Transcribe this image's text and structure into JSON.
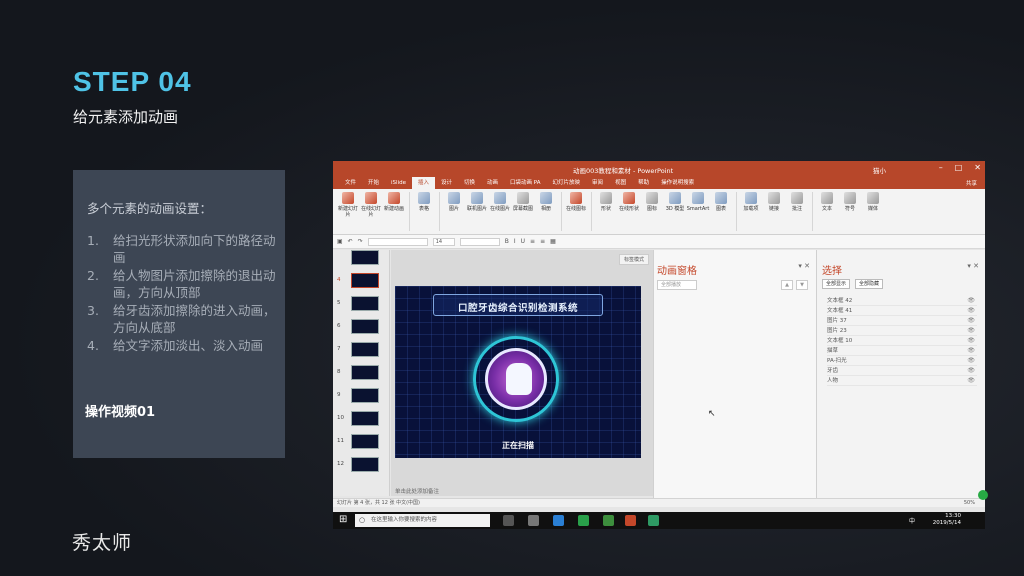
{
  "step": {
    "title": "STEP 04",
    "subtitle": "给元素添加动画"
  },
  "card": {
    "heading": "多个元素的动画设置：",
    "items": [
      {
        "num": "1.",
        "text": "给扫光形状添加向下的路径动画"
      },
      {
        "num": "2.",
        "text": "给人物图片添加擦除的退出动画，方向从顶部"
      },
      {
        "num": "3.",
        "text": "给牙齿添加擦除的进入动画，方向从底部"
      },
      {
        "num": "4.",
        "text": "给文字添加淡出、淡入动画"
      }
    ],
    "video_label": "操作视频01"
  },
  "logo": "秀太师",
  "ppt": {
    "window_title": "动画003教程和素材 - PowerPoint",
    "user": "猫小",
    "tabs": [
      "文件",
      "开始",
      "iSlide",
      "插入",
      "设计",
      "切换",
      "动画",
      "口袋动画 PA",
      "幻灯片放映",
      "审阅",
      "视图",
      "帮助",
      "操作说明搜索"
    ],
    "active_tab": "插入",
    "share": "共享",
    "ribbon": [
      {
        "label": "新建幻灯片",
        "icon": "new-slide-icon"
      },
      {
        "label": "在线幻灯片",
        "icon": "online-slide-icon"
      },
      {
        "label": "新建动画",
        "icon": "new-animation-icon"
      },
      {
        "label": "表格",
        "icon": "table-icon"
      },
      {
        "label": "图片",
        "icon": "picture-icon"
      },
      {
        "label": "联机图片",
        "icon": "online-picture-icon"
      },
      {
        "label": "在线图片",
        "icon": "web-picture-icon"
      },
      {
        "label": "屏幕截图",
        "icon": "screenshot-icon"
      },
      {
        "label": "相册",
        "icon": "album-icon"
      },
      {
        "label": "在线图标",
        "icon": "online-icon-icon"
      },
      {
        "label": "形状",
        "icon": "shapes-icon"
      },
      {
        "label": "在线形状",
        "icon": "online-shapes-icon"
      },
      {
        "label": "图标",
        "icon": "icons-icon"
      },
      {
        "label": "3D 模型",
        "icon": "3d-model-icon"
      },
      {
        "label": "SmartArt",
        "icon": "smartart-icon"
      },
      {
        "label": "图表",
        "icon": "chart-icon"
      },
      {
        "label": "加载项",
        "icon": "addins-icon"
      },
      {
        "label": "链接",
        "icon": "link-icon"
      },
      {
        "label": "批注",
        "icon": "comment-icon"
      },
      {
        "label": "文本",
        "icon": "text-icon"
      },
      {
        "label": "符号",
        "icon": "symbol-icon"
      },
      {
        "label": "媒体",
        "icon": "media-icon"
      }
    ],
    "qat": {
      "font_size": "14",
      "fit_label": "标签模式"
    },
    "thumbnails": [
      "4",
      "5",
      "6",
      "7",
      "8",
      "9",
      "10",
      "11",
      "12"
    ],
    "active_thumbnail": "4",
    "slide": {
      "title": "口腔牙齿综合识别检测系统",
      "caption": "正在扫描"
    },
    "notes": "单击此处添加备注",
    "status": {
      "left": "幻灯片 第 4 张，共 12 张    中文(中国)",
      "zoom": "50%"
    },
    "animation_pane": {
      "title": "动画窗格",
      "play_label": "全部播放"
    },
    "selection_pane": {
      "title": "选择",
      "show_all": "全部显示",
      "hide_all": "全部隐藏",
      "items": [
        "文本框 42",
        "文本框 41",
        "图片 37",
        "图片 23",
        "文本框 10",
        "描草",
        "PA-扫光",
        "牙齿",
        "人物"
      ]
    }
  },
  "taskbar": {
    "search_placeholder": "在这里输入你要搜索的内容",
    "ime": "中",
    "time": "13:30",
    "date": "2019/5/14"
  },
  "colors": {
    "accent_blue": "#4fc3e6",
    "ppt_red": "#b7472a",
    "card_bg": "#3d4654"
  }
}
